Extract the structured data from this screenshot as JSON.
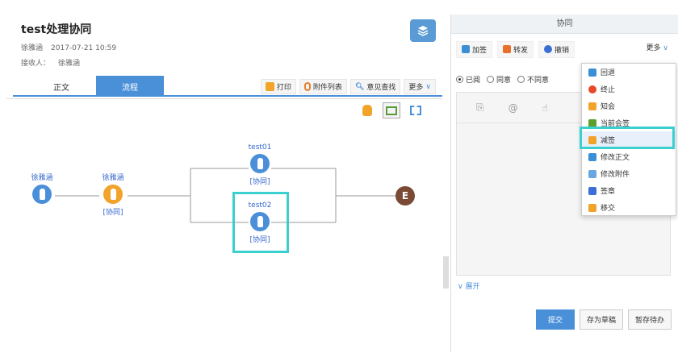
{
  "left": {
    "title": "test处理协同",
    "author": "徐雅涵",
    "datetime": "2017-07-21 10:59",
    "receiver_label": "接收人：",
    "receiver": "徐雅涵",
    "tabs": [
      "正文",
      "流程"
    ],
    "actions": [
      "打印",
      "附件列表",
      "意见查找",
      "更多"
    ]
  },
  "flow": {
    "start_name": "徐雅涵",
    "node2_name": "徐雅涵",
    "node2_tag": "[协同]",
    "branch1_name": "test01",
    "branch1_tag": "[协同]",
    "branch2_name": "test02",
    "branch2_tag": "[协同]",
    "end_label": "E"
  },
  "right": {
    "header": "协同",
    "toolbar": [
      "加签",
      "转发",
      "撤销"
    ],
    "more": "更多",
    "radios": [
      "已阅",
      "同意",
      "不同意"
    ],
    "expand": "展开",
    "footer": [
      "提交",
      "存为草稿",
      "暂存待办"
    ]
  },
  "menu": {
    "items": [
      "回退",
      "终止",
      "知会",
      "当前会签",
      "减签",
      "修改正文",
      "修改附件",
      "签章",
      "移交"
    ]
  },
  "colors": {
    "accent": "#4a90d9",
    "highlight": "#3ccfcf",
    "orange": "#f1a32a",
    "end": "#7a4a34"
  }
}
